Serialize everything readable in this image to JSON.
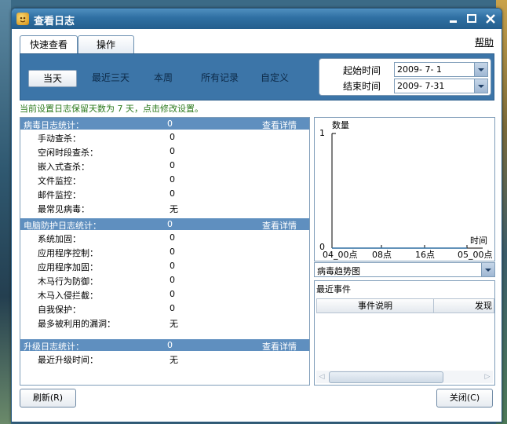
{
  "window": {
    "title": "查看日志"
  },
  "tabs": {
    "quick_view": "快速查看",
    "operations": "操作"
  },
  "help": "帮助",
  "filters": {
    "today": "当天",
    "last_three_days": "最近三天",
    "this_week": "本周",
    "all_records": "所有记录",
    "custom": "自定义"
  },
  "date_range": {
    "start_label": "起始时间",
    "start_value": "2009- 7- 1",
    "end_label": "结束时间",
    "end_value": "2009- 7-31"
  },
  "notice": "当前设置日志保留天数为 7 天，点击修改设置。",
  "stats": {
    "details_link": "查看详情",
    "virus": {
      "title": "病毒日志统计：",
      "count": "0",
      "rows": [
        {
          "label": "手动查杀：",
          "value": "0"
        },
        {
          "label": "空闲时段查杀：",
          "value": "0"
        },
        {
          "label": "嵌入式查杀：",
          "value": "0"
        },
        {
          "label": "文件监控：",
          "value": "0"
        },
        {
          "label": "邮件监控：",
          "value": "0"
        },
        {
          "label": "最常见病毒：",
          "value": "无"
        }
      ]
    },
    "protection": {
      "title": "电脑防护日志统计：",
      "count": "0",
      "rows": [
        {
          "label": "系统加固：",
          "value": "0"
        },
        {
          "label": "应用程序控制：",
          "value": "0"
        },
        {
          "label": "应用程序加固：",
          "value": "0"
        },
        {
          "label": "木马行为防御：",
          "value": "0"
        },
        {
          "label": "木马入侵拦截：",
          "value": "0"
        },
        {
          "label": "自我保护：",
          "value": "0"
        },
        {
          "label": "最多被利用的漏洞：",
          "value": "无"
        }
      ]
    },
    "upgrade": {
      "title": "升级日志统计：",
      "count": "0",
      "rows": [
        {
          "label": "最近升级时间：",
          "value": "无"
        }
      ]
    }
  },
  "chart_data": {
    "type": "line",
    "ylabel": "数量",
    "xlabel": "时间",
    "ylim": [
      0,
      1
    ],
    "y_ticks": [
      "0",
      "1"
    ],
    "categories": [
      "04_00点",
      "08点",
      "16点",
      "05_00点"
    ],
    "series": [
      {
        "values": [
          0,
          0,
          0,
          0
        ]
      }
    ],
    "grid": false
  },
  "trend_select": {
    "value": "病毒趋势图"
  },
  "events": {
    "title": "最近事件",
    "columns": {
      "description": "事件说明",
      "found": "发现"
    }
  },
  "buttons": {
    "refresh": "刷新(R)",
    "close": "关闭(C)"
  },
  "colors": {
    "title_bar": "#2f6fa2",
    "section_header": "#5f8fbf",
    "filter_bar": "#3c75a8",
    "notice": "#2c7a1c"
  }
}
